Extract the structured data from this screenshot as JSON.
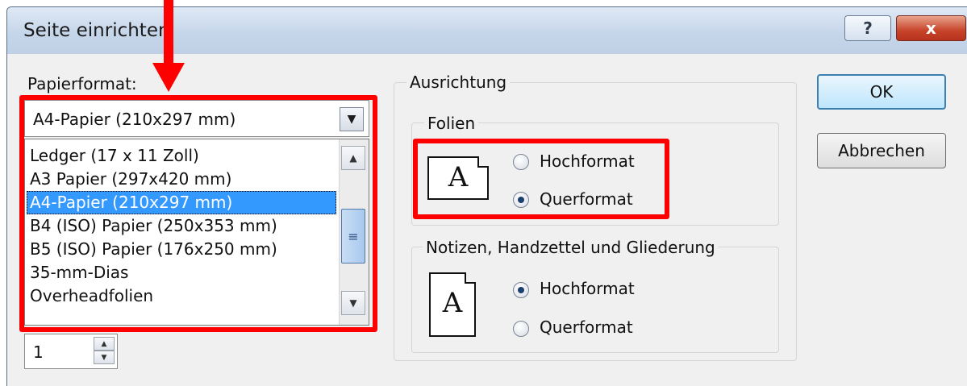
{
  "window": {
    "title": "Seite einrichten",
    "help_label": "?",
    "close_label": "x"
  },
  "paper": {
    "label": "Papierformat:",
    "selected": "A4-Papier (210x297 mm)",
    "options": [
      "Ledger (17 x 11 Zoll)",
      "A3 Papier (297x420 mm)",
      "A4-Papier (210x297 mm)",
      "B4 (ISO) Papier (250x353 mm)",
      "B5 (ISO) Papier (176x250 mm)",
      "35-mm-Dias",
      "Overheadfolien"
    ],
    "selected_index": 2
  },
  "number_value": "1",
  "orientation": {
    "title": "Ausrichtung",
    "folien": {
      "label": "Folien",
      "options": [
        "Hochformat",
        "Querformat"
      ],
      "selected": "Querformat"
    },
    "notes": {
      "label": "Notizen, Handzettel und Gliederung",
      "options": [
        "Hochformat",
        "Querformat"
      ],
      "selected": "Hochformat"
    },
    "icon_letter": "A"
  },
  "buttons": {
    "ok": "OK",
    "cancel": "Abbrechen"
  },
  "annotation": {
    "color": "#ff0000"
  }
}
